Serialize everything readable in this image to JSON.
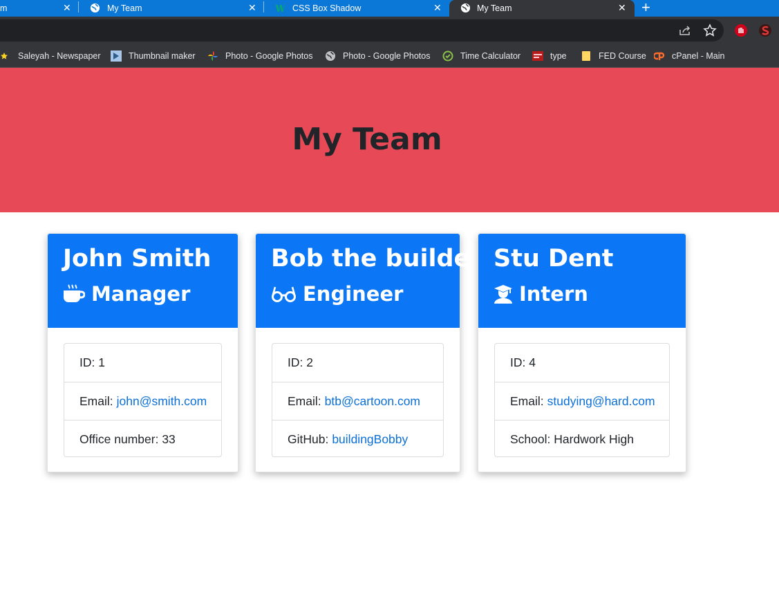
{
  "browser": {
    "tabs": [
      {
        "title": "m",
        "active": false
      },
      {
        "title": "My Team",
        "active": false
      },
      {
        "title": "CSS Box Shadow",
        "active": false
      },
      {
        "title": "My Team",
        "active": true
      }
    ],
    "close_glyph": "✕",
    "new_tab_glyph": "+",
    "toolbar_icons": [
      "share-icon",
      "star-icon",
      "extension-shield-icon",
      "extension-s-icon"
    ]
  },
  "bookmarks": [
    {
      "label": "Saleyah - Newspaper",
      "icon": "star-icon"
    },
    {
      "label": "Thumbnail maker",
      "icon": "play-icon"
    },
    {
      "label": "Photo - Google Photos",
      "icon": "pinwheel-icon"
    },
    {
      "label": "Photo - Google Photos",
      "icon": "globe-icon"
    },
    {
      "label": "Time Calculator",
      "icon": "clock-check-icon"
    },
    {
      "label": "type",
      "icon": "red-logo-icon"
    },
    {
      "label": "FED Course",
      "icon": "folder-icon"
    },
    {
      "label": "cPanel - Main",
      "icon": "cpanel-icon"
    }
  ],
  "page": {
    "title": "My Team",
    "colors": {
      "hero": "#e84956",
      "card_header": "#0b77f6",
      "link": "#0a6fd8"
    },
    "cards": [
      {
        "name": "John Smith",
        "role": "Manager",
        "role_icon": "mug-icon",
        "id_label": "ID:",
        "id": "1",
        "email_label": "Email:",
        "email": "john@smith.com",
        "extra_label": "Office number:",
        "extra": "33",
        "extra_is_link": false
      },
      {
        "name": "Bob the builder",
        "role": "Engineer",
        "role_icon": "glasses-icon",
        "id_label": "ID:",
        "id": "2",
        "email_label": "Email:",
        "email": "btb@cartoon.com",
        "extra_label": "GitHub:",
        "extra": "buildingBobby",
        "extra_is_link": true
      },
      {
        "name": "Stu Dent",
        "role": "Intern",
        "role_icon": "graduate-icon",
        "id_label": "ID:",
        "id": "4",
        "email_label": "Email:",
        "email": "studying@hard.com",
        "extra_label": "School:",
        "extra": "Hardwork High",
        "extra_is_link": false
      }
    ]
  }
}
